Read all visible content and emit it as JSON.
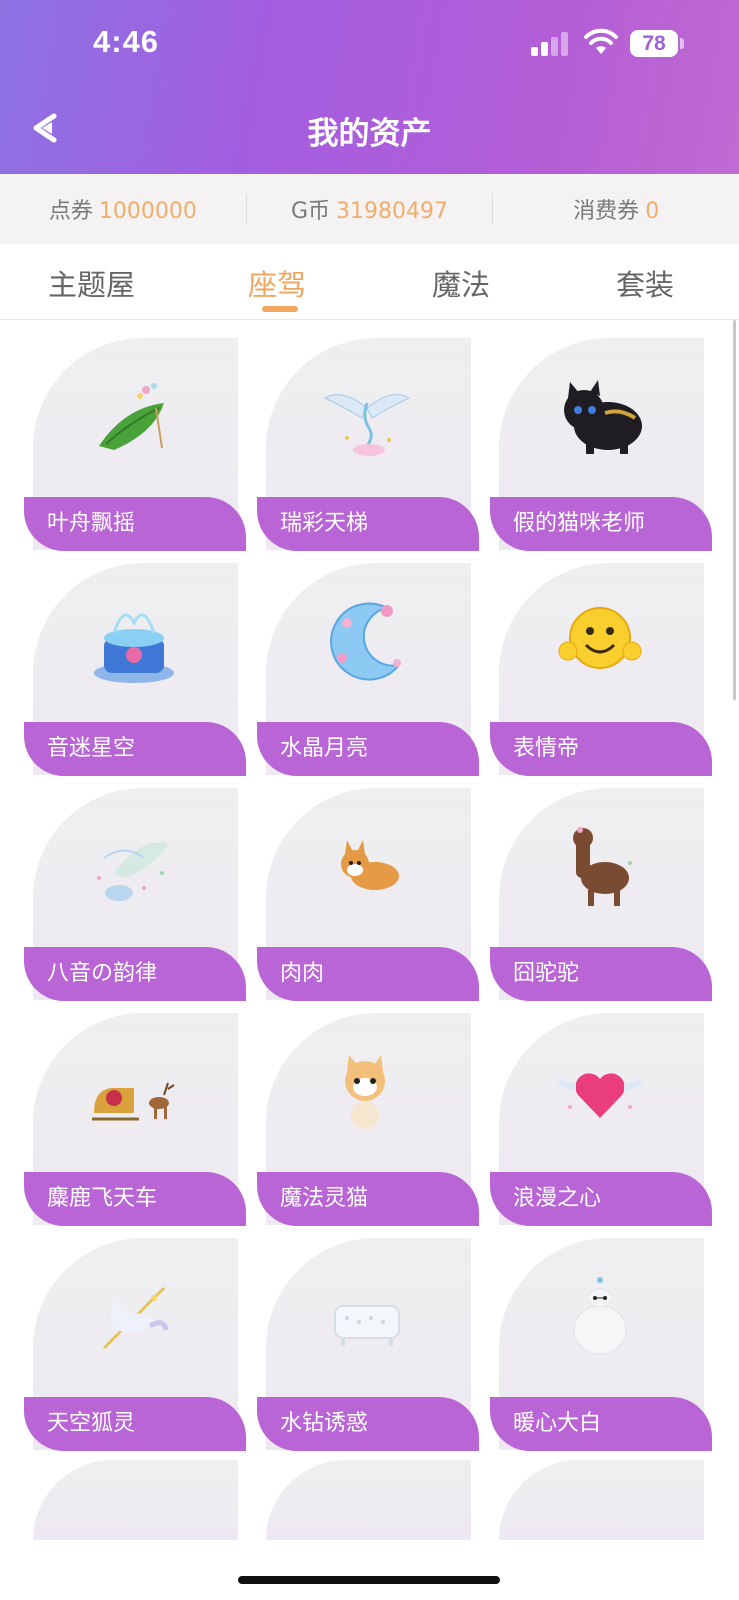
{
  "status_bar": {
    "time": "4:46",
    "battery": "78"
  },
  "header": {
    "title": "我的资产"
  },
  "balances": [
    {
      "label": "点券",
      "value": "1000000"
    },
    {
      "label": "G币",
      "value": "31980497"
    },
    {
      "label": "消费券",
      "value": "0"
    }
  ],
  "tabs": [
    {
      "label": "主题屋"
    },
    {
      "label": "座驾"
    },
    {
      "label": "魔法"
    },
    {
      "label": "套装"
    }
  ],
  "active_tab": "座驾",
  "items": [
    {
      "name": "叶舟飘摇",
      "icon": "leaf-boat-icon"
    },
    {
      "name": "瑞彩天梯",
      "icon": "winged-ladder-icon"
    },
    {
      "name": "假的猫咪老师",
      "icon": "black-cat-icon"
    },
    {
      "name": "音迷星空",
      "icon": "crystal-fountain-icon"
    },
    {
      "name": "水晶月亮",
      "icon": "crystal-moon-icon"
    },
    {
      "name": "表情帝",
      "icon": "smiley-icon"
    },
    {
      "name": "八音の韵律",
      "icon": "music-box-icon"
    },
    {
      "name": "肉肉",
      "icon": "corgi-icon"
    },
    {
      "name": "囧驼驼",
      "icon": "alpaca-icon"
    },
    {
      "name": "麋鹿飞天车",
      "icon": "reindeer-sleigh-icon"
    },
    {
      "name": "魔法灵猫",
      "icon": "magic-cat-icon"
    },
    {
      "name": "浪漫之心",
      "icon": "winged-heart-icon"
    },
    {
      "name": "天空狐灵",
      "icon": "sky-fox-icon"
    },
    {
      "name": "水钻诱惑",
      "icon": "diamond-bathtub-icon"
    },
    {
      "name": "暖心大白",
      "icon": "baymax-icon"
    }
  ],
  "colors": {
    "accent": "#f0a65e",
    "label_purple": "#b965d6",
    "header_start": "#8d72e2",
    "header_end": "#c06ad3"
  }
}
